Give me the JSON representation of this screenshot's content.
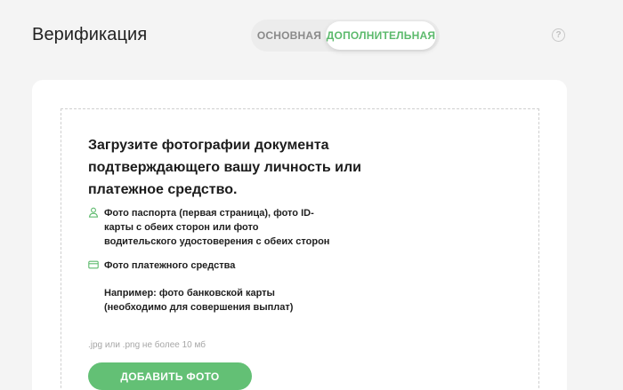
{
  "header": {
    "title": "Верификация",
    "help_glyph": "?",
    "help_icon": "question-circle-icon"
  },
  "tabs": [
    {
      "label": "ОСНОВНАЯ",
      "active": false
    },
    {
      "label": "ДОПОЛНИТЕЛЬНАЯ",
      "active": true
    }
  ],
  "upload": {
    "heading": "Загрузите фотографии документа подтверждающего вашу личность или платежное средство.",
    "requirements": [
      {
        "icon": "person-icon",
        "text": "Фото паспорта (первая страница), фото ID-карты с обеих сторон или фото водительского удостоверения с обеих сторон"
      },
      {
        "icon": "credit-card-icon",
        "text": "Фото платежного средства"
      }
    ],
    "example": "Например: фото банковской карты (необходимо для совершения выплат)",
    "format_note": ".jpg или .png не более 10 мб",
    "button_label": "ДОБАВИТЬ ФОТО"
  },
  "colors": {
    "accent": "#5dba6d",
    "button": "#63c075",
    "background": "#f4f4f4",
    "card": "#ffffff"
  }
}
